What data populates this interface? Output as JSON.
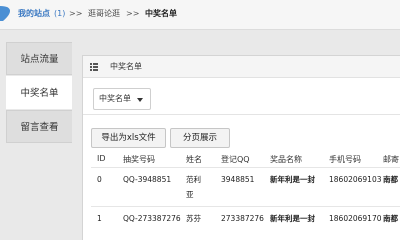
{
  "breadcrumb": {
    "site_label": "我的站点",
    "site_count": "(1)",
    "sep": ">>",
    "item1": "逛哥论逛",
    "item2": "中奖名单"
  },
  "sidebar": {
    "items": [
      {
        "label": "站点流量"
      },
      {
        "label": "中奖名单"
      },
      {
        "label": "留言查看"
      }
    ]
  },
  "panel": {
    "title": "中奖名单",
    "dropdown_label": "中奖名单",
    "export_label": "导出为xls文件",
    "paging_label": "分页展示"
  },
  "table": {
    "headers": [
      "ID",
      "抽奖号码",
      "姓名",
      "登记QQ",
      "奖品名称",
      "手机号码",
      "邮寄"
    ],
    "rows": [
      [
        "0",
        "QQ-3948851",
        "范利亚",
        "3948851",
        "新年利是一封",
        "18602069103",
        "南都"
      ],
      [
        "1",
        "QQ-273387276",
        "苏芬",
        "273387276",
        "新年利是一封",
        "18602069170",
        "南都"
      ]
    ]
  },
  "colors": {
    "link": "#3a78c2",
    "pin": "#4a8fd4"
  }
}
